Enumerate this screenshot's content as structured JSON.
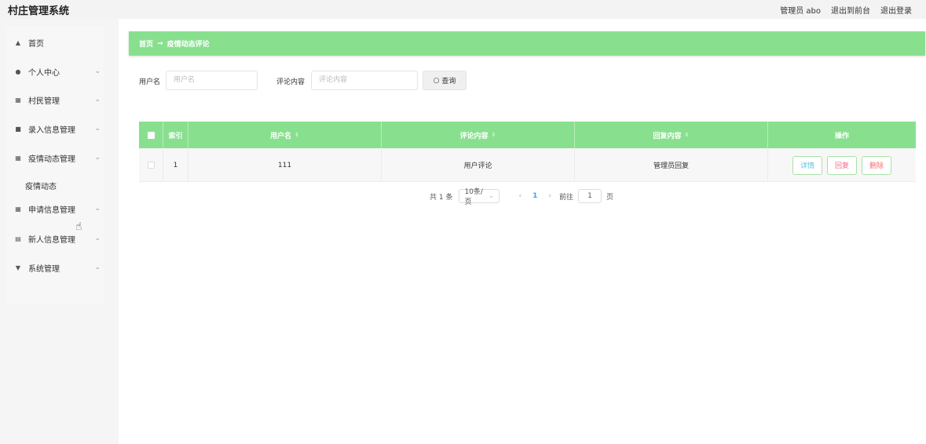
{
  "header": {
    "app_title": "村庄管理系统",
    "admin_label": "管理员 abo",
    "to_front": "退出到前台",
    "logout": "退出登录"
  },
  "sidebar": {
    "items": [
      {
        "label": "首页",
        "icon": "home-icon"
      },
      {
        "label": "个人中心",
        "icon": "user-icon"
      },
      {
        "label": "村民管理",
        "icon": "grid-icon"
      },
      {
        "label": "录入信息管理",
        "icon": "thumb-icon"
      },
      {
        "label": "疫情动态管理",
        "icon": "grid-icon"
      },
      {
        "label": "申请信息管理",
        "icon": "grid-icon"
      },
      {
        "label": "新人信息管理",
        "icon": "document-icon"
      },
      {
        "label": "系统管理",
        "icon": "cup-icon"
      }
    ],
    "sub_item": "疫情动态"
  },
  "breadcrumb": {
    "home": "首页",
    "arrow": "→",
    "current": "疫情动态评论"
  },
  "search": {
    "username_label": "用户名",
    "username_placeholder": "用户名",
    "content_label": "评论内容",
    "content_placeholder": "评论内容",
    "query_button": "查询"
  },
  "table": {
    "columns": [
      "",
      "索引",
      "用户名",
      "评论内容",
      "回复内容",
      "操作"
    ],
    "rows": [
      {
        "index": "1",
        "username": "111",
        "comment": "用户评论",
        "reply": "管理员回复"
      }
    ],
    "actions": {
      "detail": "详情",
      "reply": "回复",
      "delete": "删除"
    }
  },
  "pagination": {
    "total": "共 1 条",
    "page_size": "10条/页",
    "current_page": "1",
    "goto_label": "前往",
    "goto_value": "1",
    "page_suffix": "页"
  },
  "colors": {
    "accent_green": "#88e08f",
    "link_blue": "#409eff",
    "detail": "#5bc0de",
    "reply": "#f56c8a",
    "delete": "#f56c6c"
  }
}
